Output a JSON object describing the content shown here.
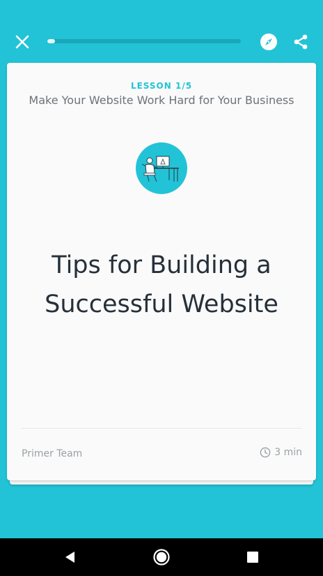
{
  "top_bar": {
    "progress_percent": 4,
    "close_icon": "close-icon",
    "explore_icon": "compass-icon",
    "share_icon": "share-icon"
  },
  "card": {
    "lesson_label": "LESSON 1/5",
    "course_title": "Make Your Website Work Hard for Your Business",
    "lesson_title": "Tips for Building a Successful Website",
    "author": "Primer Team",
    "duration": "3 min"
  },
  "colors": {
    "background": "#22c3d6",
    "accent": "#22c3d6",
    "card": "#fafafa",
    "title_text": "#26303a",
    "muted_text": "#9aa1a5"
  },
  "nav": {
    "back_icon": "back-triangle-icon",
    "home_icon": "home-circle-icon",
    "recents_icon": "recents-square-icon"
  }
}
